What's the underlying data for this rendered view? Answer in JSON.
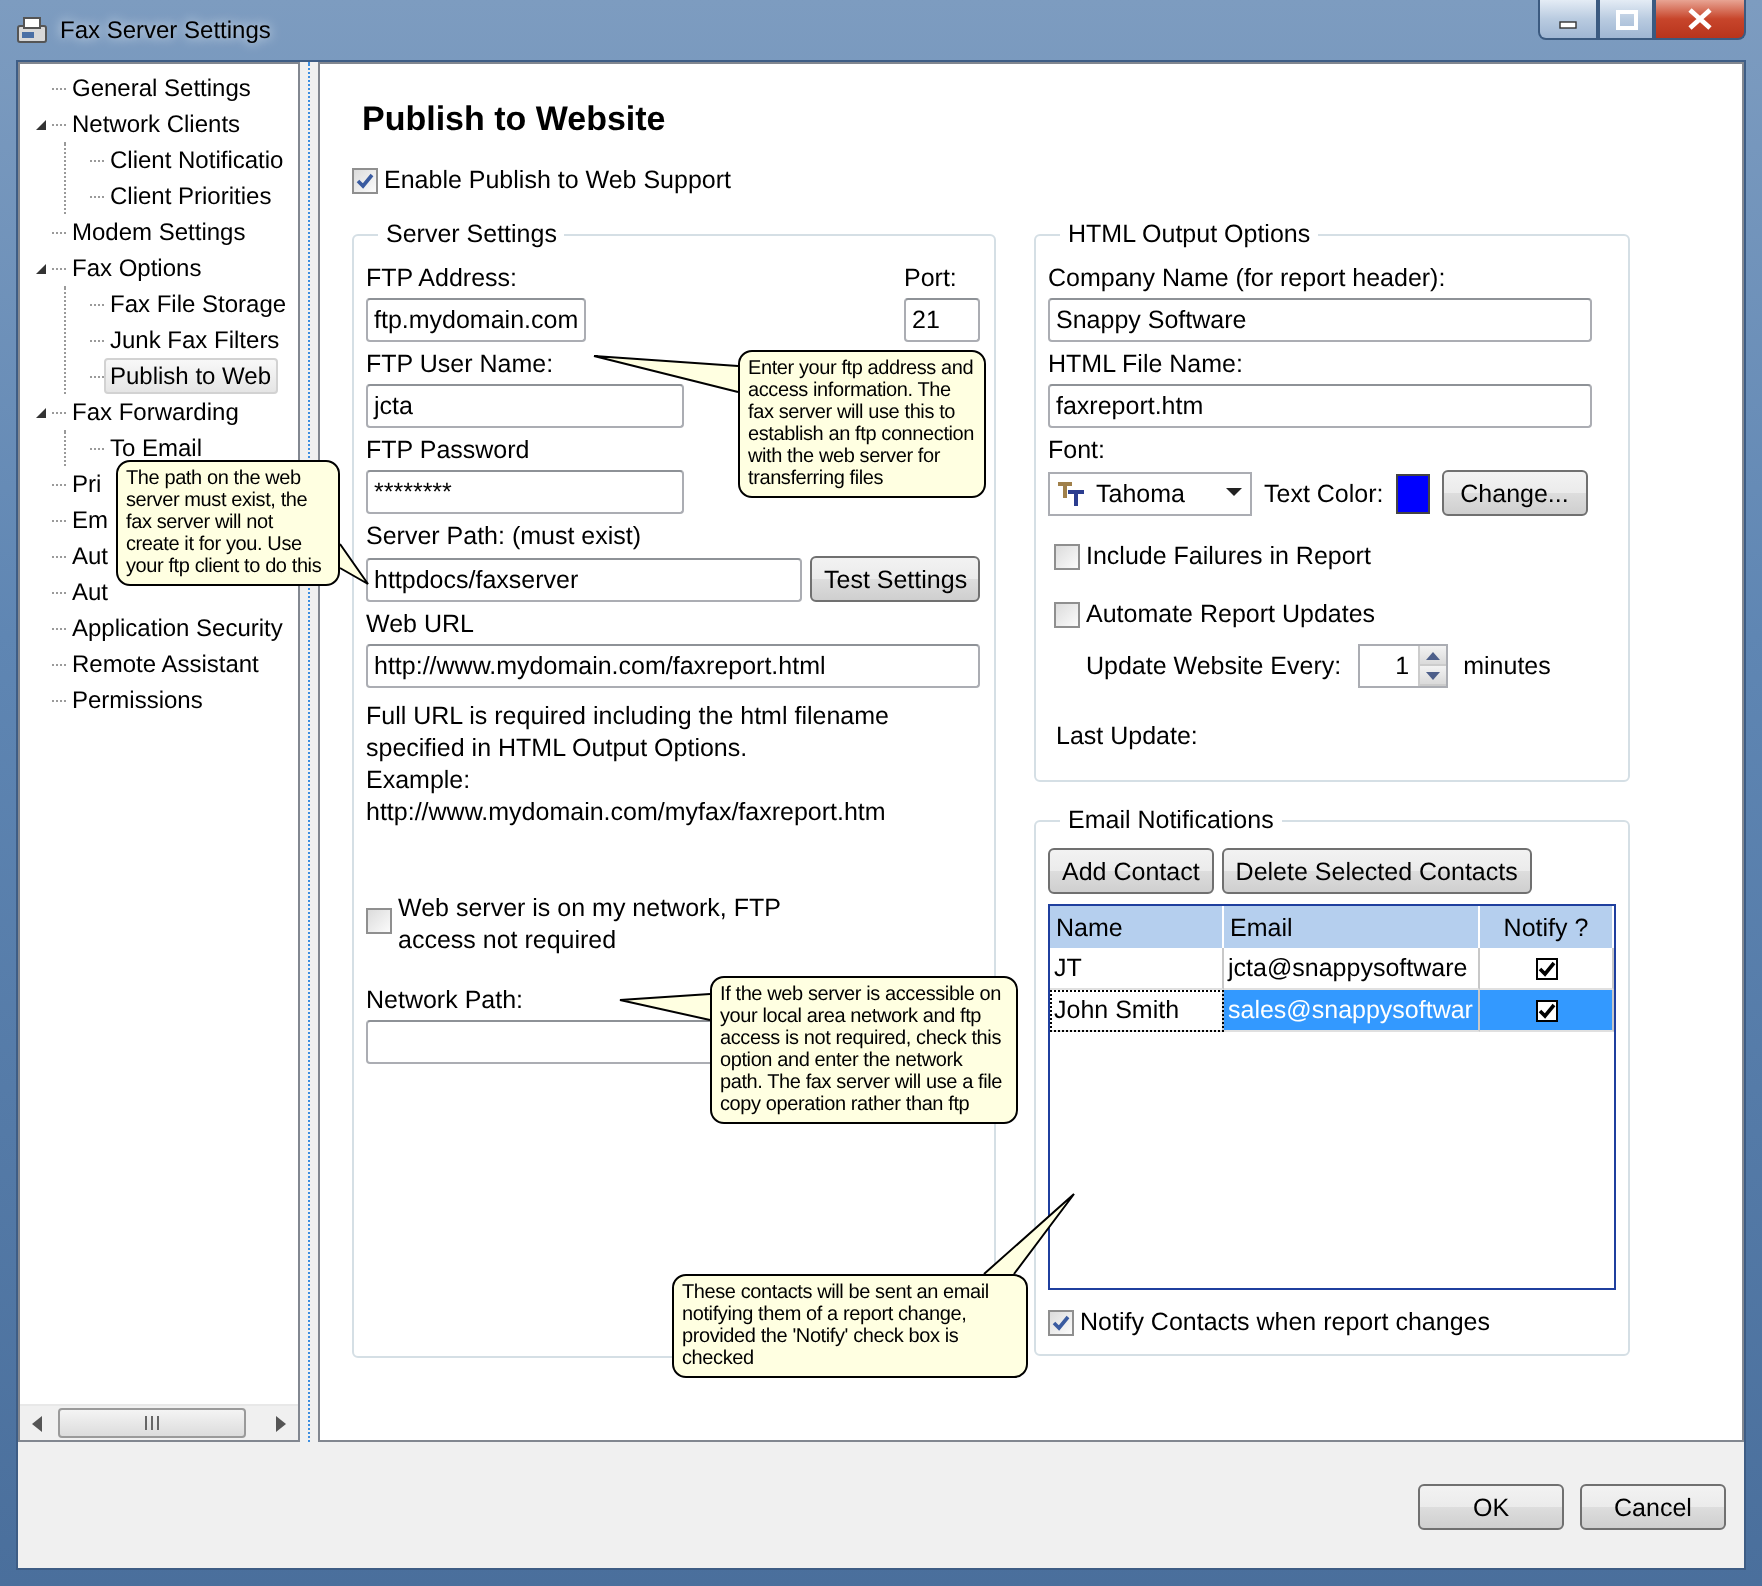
{
  "window": {
    "title": "Fax Server Settings"
  },
  "sidebar": {
    "items": [
      {
        "label": "General Settings",
        "selected": false
      },
      {
        "label": "Network Clients",
        "selected": false,
        "expanded": true,
        "children": [
          {
            "label": "Client Notificatio",
            "selected": false
          },
          {
            "label": "Client Priorities",
            "selected": false
          }
        ]
      },
      {
        "label": "Modem Settings",
        "selected": false
      },
      {
        "label": "Fax Options",
        "selected": false,
        "expanded": true,
        "children": [
          {
            "label": "Fax File Storage",
            "selected": false
          },
          {
            "label": "Junk Fax Filters",
            "selected": false
          },
          {
            "label": "Publish to Web",
            "selected": true
          }
        ]
      },
      {
        "label": "Fax Forwarding",
        "selected": false,
        "expanded": true,
        "children": [
          {
            "label": "To Email",
            "selected": false
          }
        ]
      },
      {
        "label": "Pri",
        "selected": false
      },
      {
        "label": "Em",
        "selected": false
      },
      {
        "label": "Aut",
        "selected": false
      },
      {
        "label": "Aut",
        "selected": false
      },
      {
        "label": "Application Security",
        "selected": false
      },
      {
        "label": "Remote Assistant",
        "selected": false
      },
      {
        "label": "Permissions",
        "selected": false
      }
    ]
  },
  "page": {
    "title": "Publish to Website",
    "enable": {
      "label": "Enable Publish to Web Support",
      "checked": true
    }
  },
  "server_settings": {
    "title": "Server Settings",
    "ftp_address": {
      "label": "FTP Address:",
      "value": "ftp.mydomain.com"
    },
    "port": {
      "label": "Port:",
      "value": "21"
    },
    "user_name": {
      "label": "FTP User Name:",
      "value": "jcta"
    },
    "password": {
      "label": "FTP Password",
      "value": "********"
    },
    "server_path": {
      "label": "Server Path: (must exist)",
      "value": "httpdocs/faxserver"
    },
    "test_button": "Test Settings",
    "web_url": {
      "label": "Web URL",
      "value": "http://www.mydomain.com/faxreport.html"
    },
    "note": "Full URL is required including the html filename specified in HTML Output Options.",
    "example_label": "Example:",
    "example": "http://www.mydomain.com/myfax/faxreport.htm",
    "local_network": {
      "label": "Web server is on my network, FTP access not required",
      "checked": false
    },
    "network_path": {
      "label": "Network Path:"
    }
  },
  "html_output": {
    "title": "HTML Output Options",
    "company_name": {
      "label": "Company Name (for report header):",
      "value": "Snappy Software"
    },
    "file_name": {
      "label": "HTML File Name:",
      "value": "faxreport.htm"
    },
    "font": {
      "label": "Font:",
      "value": "Tahoma"
    },
    "text_color": {
      "label": "Text Color:",
      "color": "#0000ff"
    },
    "change_button": "Change...",
    "include_failures": {
      "label": "Include Failures in Report",
      "checked": false
    },
    "automate": {
      "label": "Automate Report Updates",
      "checked": false
    },
    "update_every": {
      "label": "Update Website Every:",
      "value": "1",
      "unit": "minutes"
    },
    "last_update": {
      "label": "Last Update:"
    }
  },
  "email": {
    "title": "Email Notifications",
    "buttons": [
      "Add Contact",
      "Delete Selected Contacts"
    ],
    "columns": [
      "Name",
      "Email",
      "Notify ?"
    ],
    "rows": [
      {
        "name": "JT",
        "email": "jcta@snappysoftware",
        "notify": true,
        "selected": false
      },
      {
        "name": "John Smith",
        "email": "sales@snappysoftwar",
        "notify": true,
        "selected": true
      }
    ],
    "notify_contacts": {
      "label": "Notify Contacts when report changes",
      "checked": true
    }
  },
  "tooltips": [
    {
      "text": "The path on the web server must exist, the fax server will not create it for you. Use your ftp client to do this"
    },
    {
      "text": "Enter your ftp address and access information.  The fax server will use this to establish an ftp connection with the web server for transferring files"
    },
    {
      "text": "If the web server is accessible on your local area network and ftp access is not required, check this option and enter the network path. The fax server will use a file copy operation rather than ftp"
    },
    {
      "text": "These contacts will be sent an email notifying them of a report change, provided the 'Notify' check box is checked"
    }
  ],
  "buttons": [
    "OK",
    "Cancel"
  ]
}
